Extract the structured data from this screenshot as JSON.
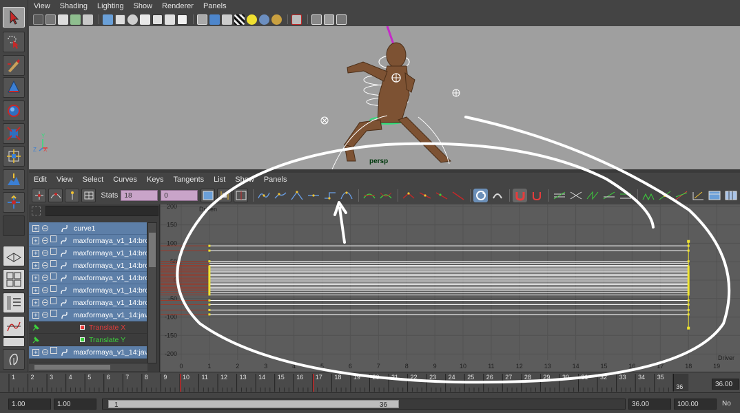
{
  "viewport_menu": [
    "View",
    "Shading",
    "Lighting",
    "Show",
    "Renderer",
    "Panels"
  ],
  "viewport": {
    "camera_label": "persp",
    "axis_y": "Y",
    "axis_z": "Z",
    "axis_x": "X"
  },
  "graph_menu": [
    "Edit",
    "View",
    "Select",
    "Curves",
    "Keys",
    "Tangents",
    "List",
    "Show",
    "Panels"
  ],
  "graph_toolbar": {
    "stats_label": "Stats",
    "stats_value_1": "18",
    "stats_value_2": "0"
  },
  "outliner": {
    "rows": [
      {
        "label": "curve1",
        "type": "curve"
      },
      {
        "label": "maxformaya_v1_14:bro",
        "type": "node"
      },
      {
        "label": "maxformaya_v1_14:bro",
        "type": "node"
      },
      {
        "label": "maxformaya_v1_14:bro",
        "type": "node"
      },
      {
        "label": "maxformaya_v1_14:bro",
        "type": "node"
      },
      {
        "label": "maxformaya_v1_14:bro",
        "type": "node"
      },
      {
        "label": "maxformaya_v1_14:bro",
        "type": "node"
      },
      {
        "label": "maxformaya_v1_14:jav",
        "type": "node"
      },
      {
        "label": "Translate X",
        "type": "channel",
        "color": "#e63c3c"
      },
      {
        "label": "Translate Y",
        "type": "channel",
        "color": "#3cd23c"
      },
      {
        "label": "maxformaya_v1_14:jav",
        "type": "node"
      }
    ]
  },
  "graph": {
    "title_label": "Driven",
    "x_axis_label": "Driver",
    "y_ticks": [
      "200",
      "150",
      "100",
      "50",
      "0",
      "-50",
      "-100",
      "-150",
      "-200"
    ],
    "x_ticks": [
      "0",
      "1",
      "2",
      "3",
      "4",
      "5",
      "6",
      "7",
      "8",
      "9",
      "10",
      "11",
      "12",
      "13",
      "14",
      "15",
      "16",
      "17",
      "18",
      "19"
    ]
  },
  "timeslider": {
    "ticks": [
      "1",
      "2",
      "3",
      "4",
      "5",
      "6",
      "7",
      "8",
      "9",
      "10",
      "11",
      "12",
      "13",
      "14",
      "15",
      "16",
      "17",
      "18",
      "19",
      "20",
      "21",
      "22",
      "23",
      "24",
      "25",
      "26",
      "27",
      "28",
      "29",
      "30",
      "31",
      "32",
      "33",
      "34",
      "35",
      "36"
    ],
    "end_marker": "36",
    "current_time": "36.00"
  },
  "range_bar": {
    "start_time": "1.00",
    "range_start": "1.00",
    "slider_start": "1",
    "slider_end": "36",
    "range_end": "36.00",
    "end_time": "100.00",
    "extra": "No"
  }
}
